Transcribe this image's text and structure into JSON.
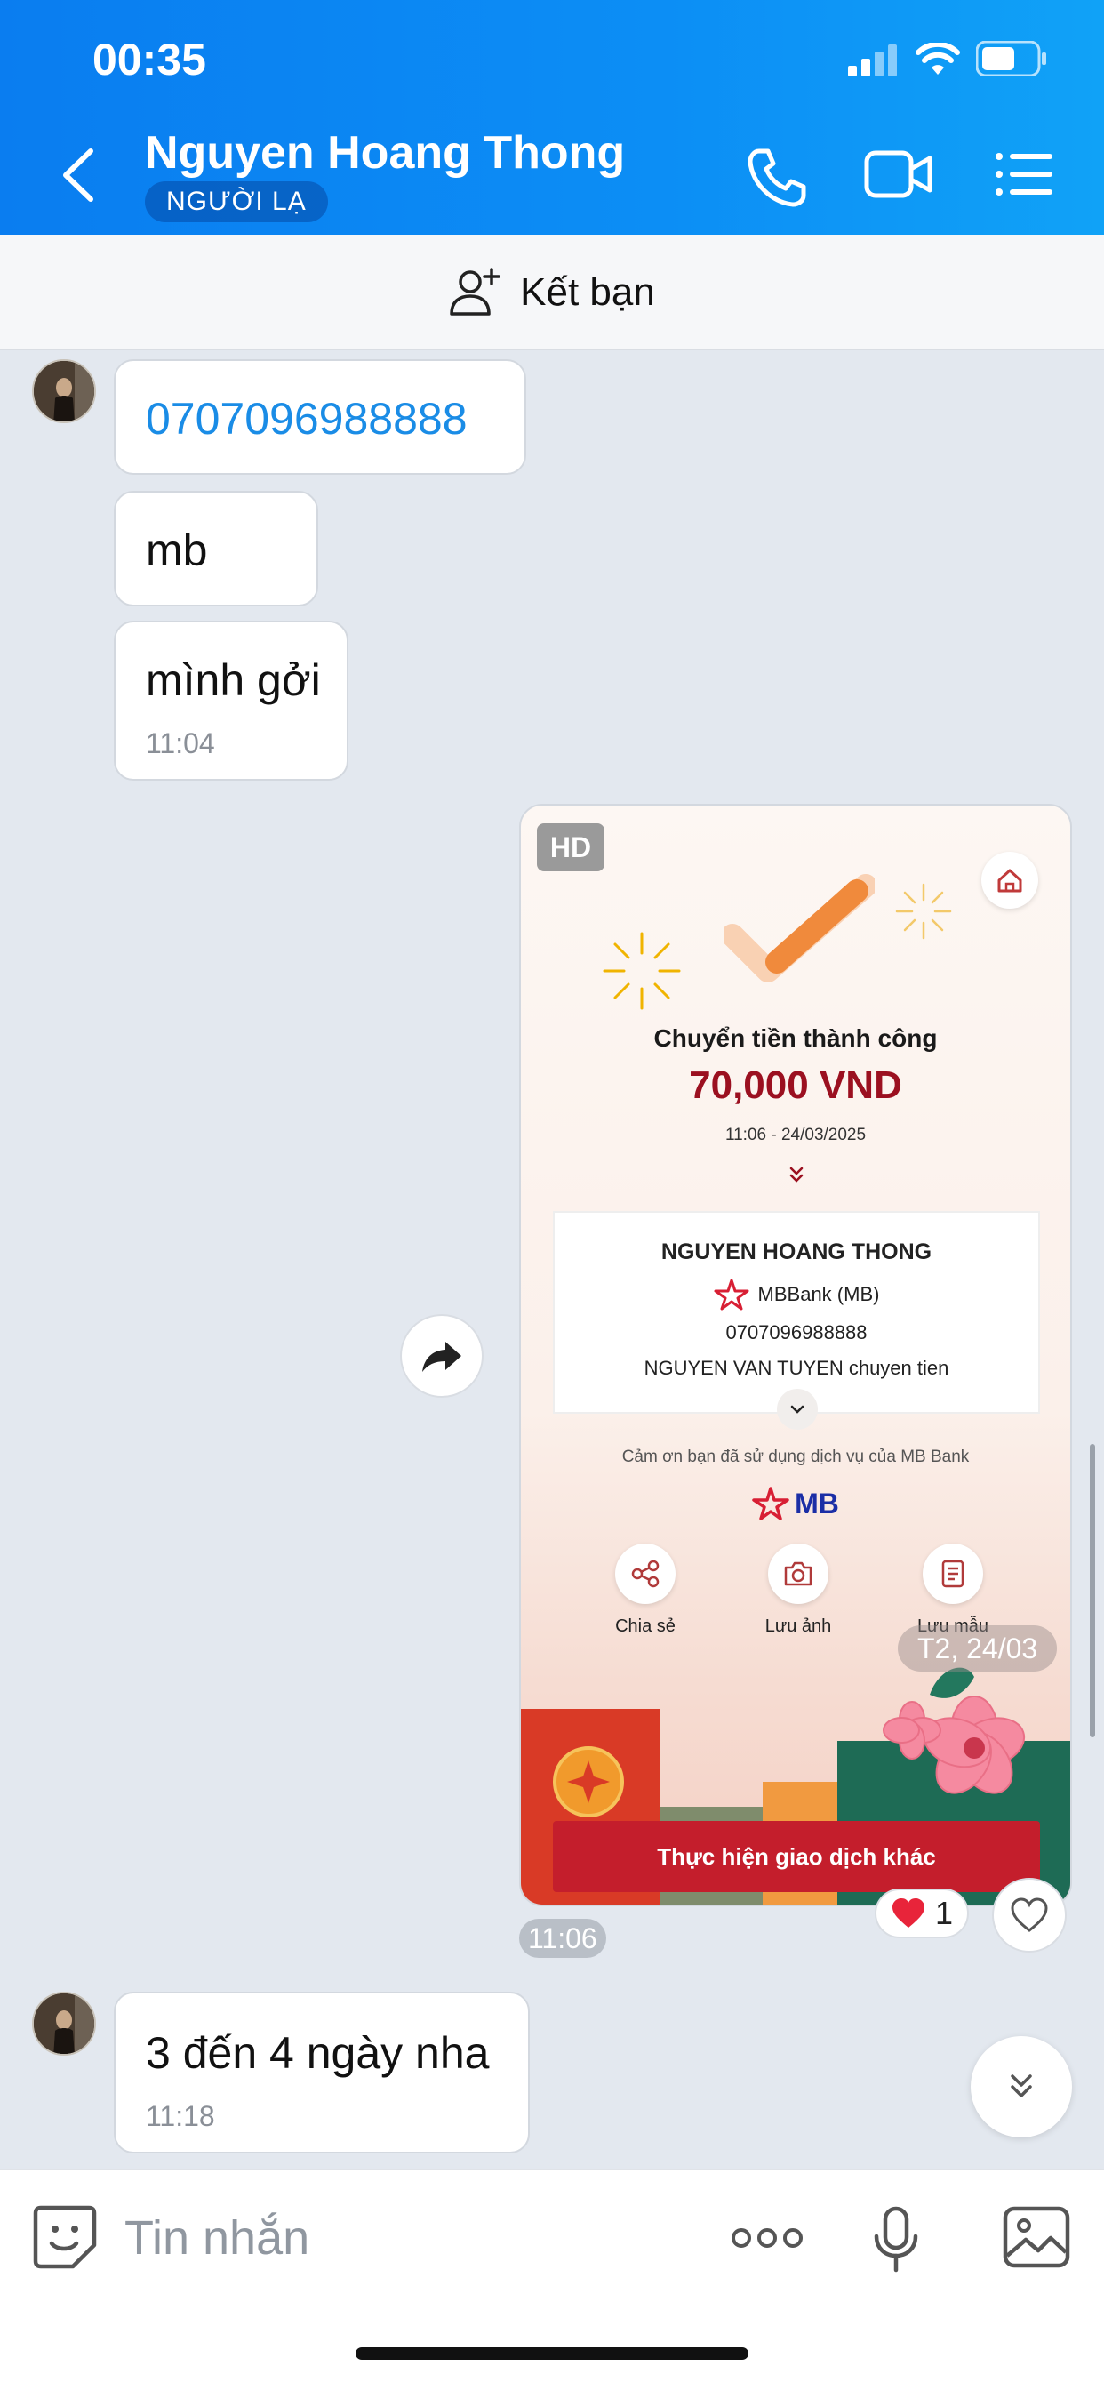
{
  "status_bar": {
    "time": "00:35"
  },
  "header": {
    "contact_name": "Nguyen Hoang Thong",
    "badge": "NGƯỜI LẠ",
    "icons": [
      "back-icon",
      "phone-icon",
      "video-camera-icon",
      "list-menu-icon"
    ]
  },
  "add_friend": {
    "label": "Kết bạn",
    "icon": "add-user-icon"
  },
  "messages": [
    {
      "text": "0707096988888",
      "color": "#1a8ce6"
    },
    {
      "text": "mb"
    },
    {
      "text": "mình gởi",
      "time": "11:04"
    }
  ],
  "receipt": {
    "hd_badge": "HD",
    "status": "Chuyển tiền thành công",
    "amount": "70,000 VND",
    "datetime": "11:06 - 24/03/2025",
    "recipient_name": "NGUYEN HOANG THONG",
    "bank": "MBBank (MB)",
    "account": "0707096988888",
    "note": "NGUYEN VAN TUYEN chuyen tien",
    "thanks": "Cảm ơn bạn đã sử dụng dịch vụ của MB Bank",
    "logo_text": "MB",
    "actions": [
      {
        "label": "Chia sẻ",
        "icon": "share-icon"
      },
      {
        "label": "Lưu ảnh",
        "icon": "camera-icon"
      },
      {
        "label": "Lưu mẫu",
        "icon": "template-icon"
      }
    ],
    "cta": "Thực hiện giao dịch khác",
    "date_pill": "T2, 24/03",
    "sent_time": "11:06",
    "reaction_count": "1",
    "colors": {
      "amount": "#9b1020",
      "cta": "#c41e2c"
    }
  },
  "last_message": {
    "text": "3 đến 4 ngày nha",
    "time": "11:18"
  },
  "input": {
    "placeholder": "Tin nhắn"
  }
}
